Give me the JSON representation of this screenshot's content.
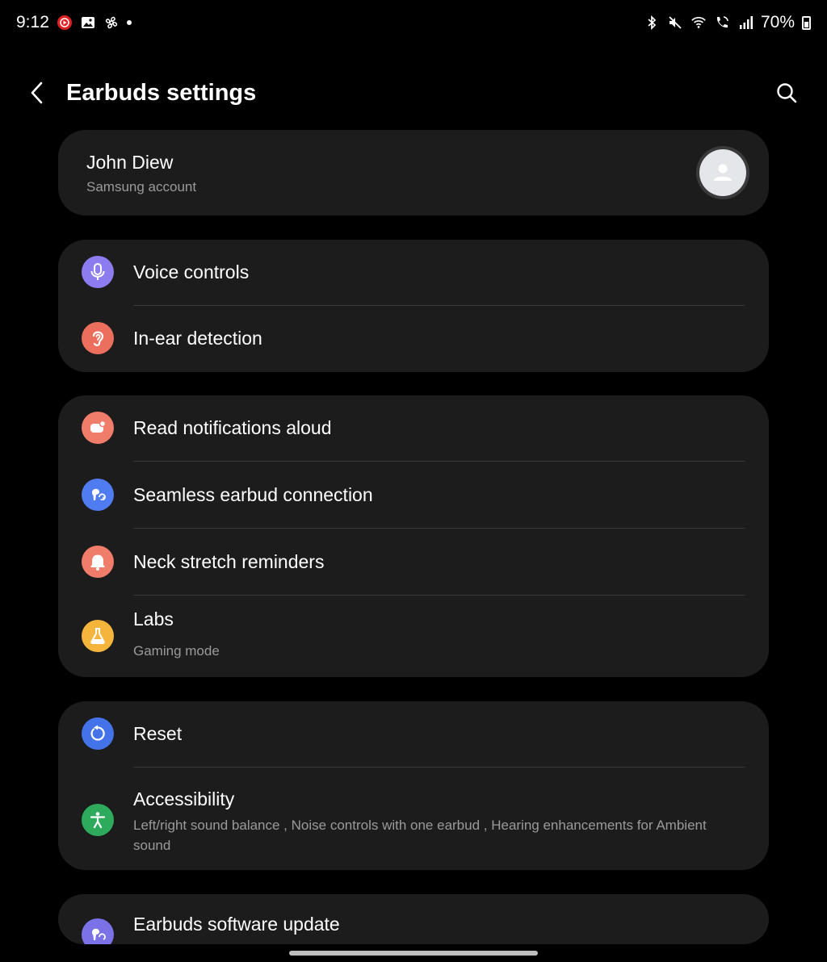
{
  "status_bar": {
    "time": "9:12",
    "battery": "70%",
    "left_icons": [
      "youtube-music-icon",
      "gallery-icon",
      "fan-icon",
      "notification-dot"
    ],
    "right_icons": [
      "bluetooth-icon",
      "mute-icon",
      "wifi-icon",
      "wifi-calling-icon",
      "signal-icon",
      "battery-icon"
    ]
  },
  "header": {
    "title": "Earbuds settings"
  },
  "account": {
    "name": "John Diew",
    "subtitle": "Samsung account"
  },
  "groups": [
    {
      "items": [
        {
          "label": "Voice controls",
          "icon": "microphone-icon",
          "color": "#8d7cf0"
        },
        {
          "label": "In-ear detection",
          "icon": "ear-icon",
          "color": "#ec6f5e"
        }
      ]
    },
    {
      "items": [
        {
          "label": "Read notifications aloud",
          "icon": "notification-speech-icon",
          "color": "#f07c6a"
        },
        {
          "label": "Seamless earbud connection",
          "icon": "earbud-connection-icon",
          "color": "#4f7cf0"
        },
        {
          "label": "Neck stretch reminders",
          "icon": "bell-icon",
          "color": "#f07c6a"
        },
        {
          "label": "Labs",
          "subtitle": "Gaming mode",
          "icon": "flask-icon",
          "color": "#f5b53c"
        }
      ]
    },
    {
      "items": [
        {
          "label": "Reset",
          "icon": "reset-icon",
          "color": "#4472e8"
        },
        {
          "label": "Accessibility",
          "subtitle": "Left/right sound balance , Noise controls with one earbud , Hearing enhancements for Ambient sound",
          "icon": "accessibility-icon",
          "color": "#2eaa5c"
        }
      ]
    },
    {
      "items": [
        {
          "label": "Earbuds software update",
          "icon": "software-update-icon",
          "color": "#7a72e6"
        }
      ]
    }
  ]
}
